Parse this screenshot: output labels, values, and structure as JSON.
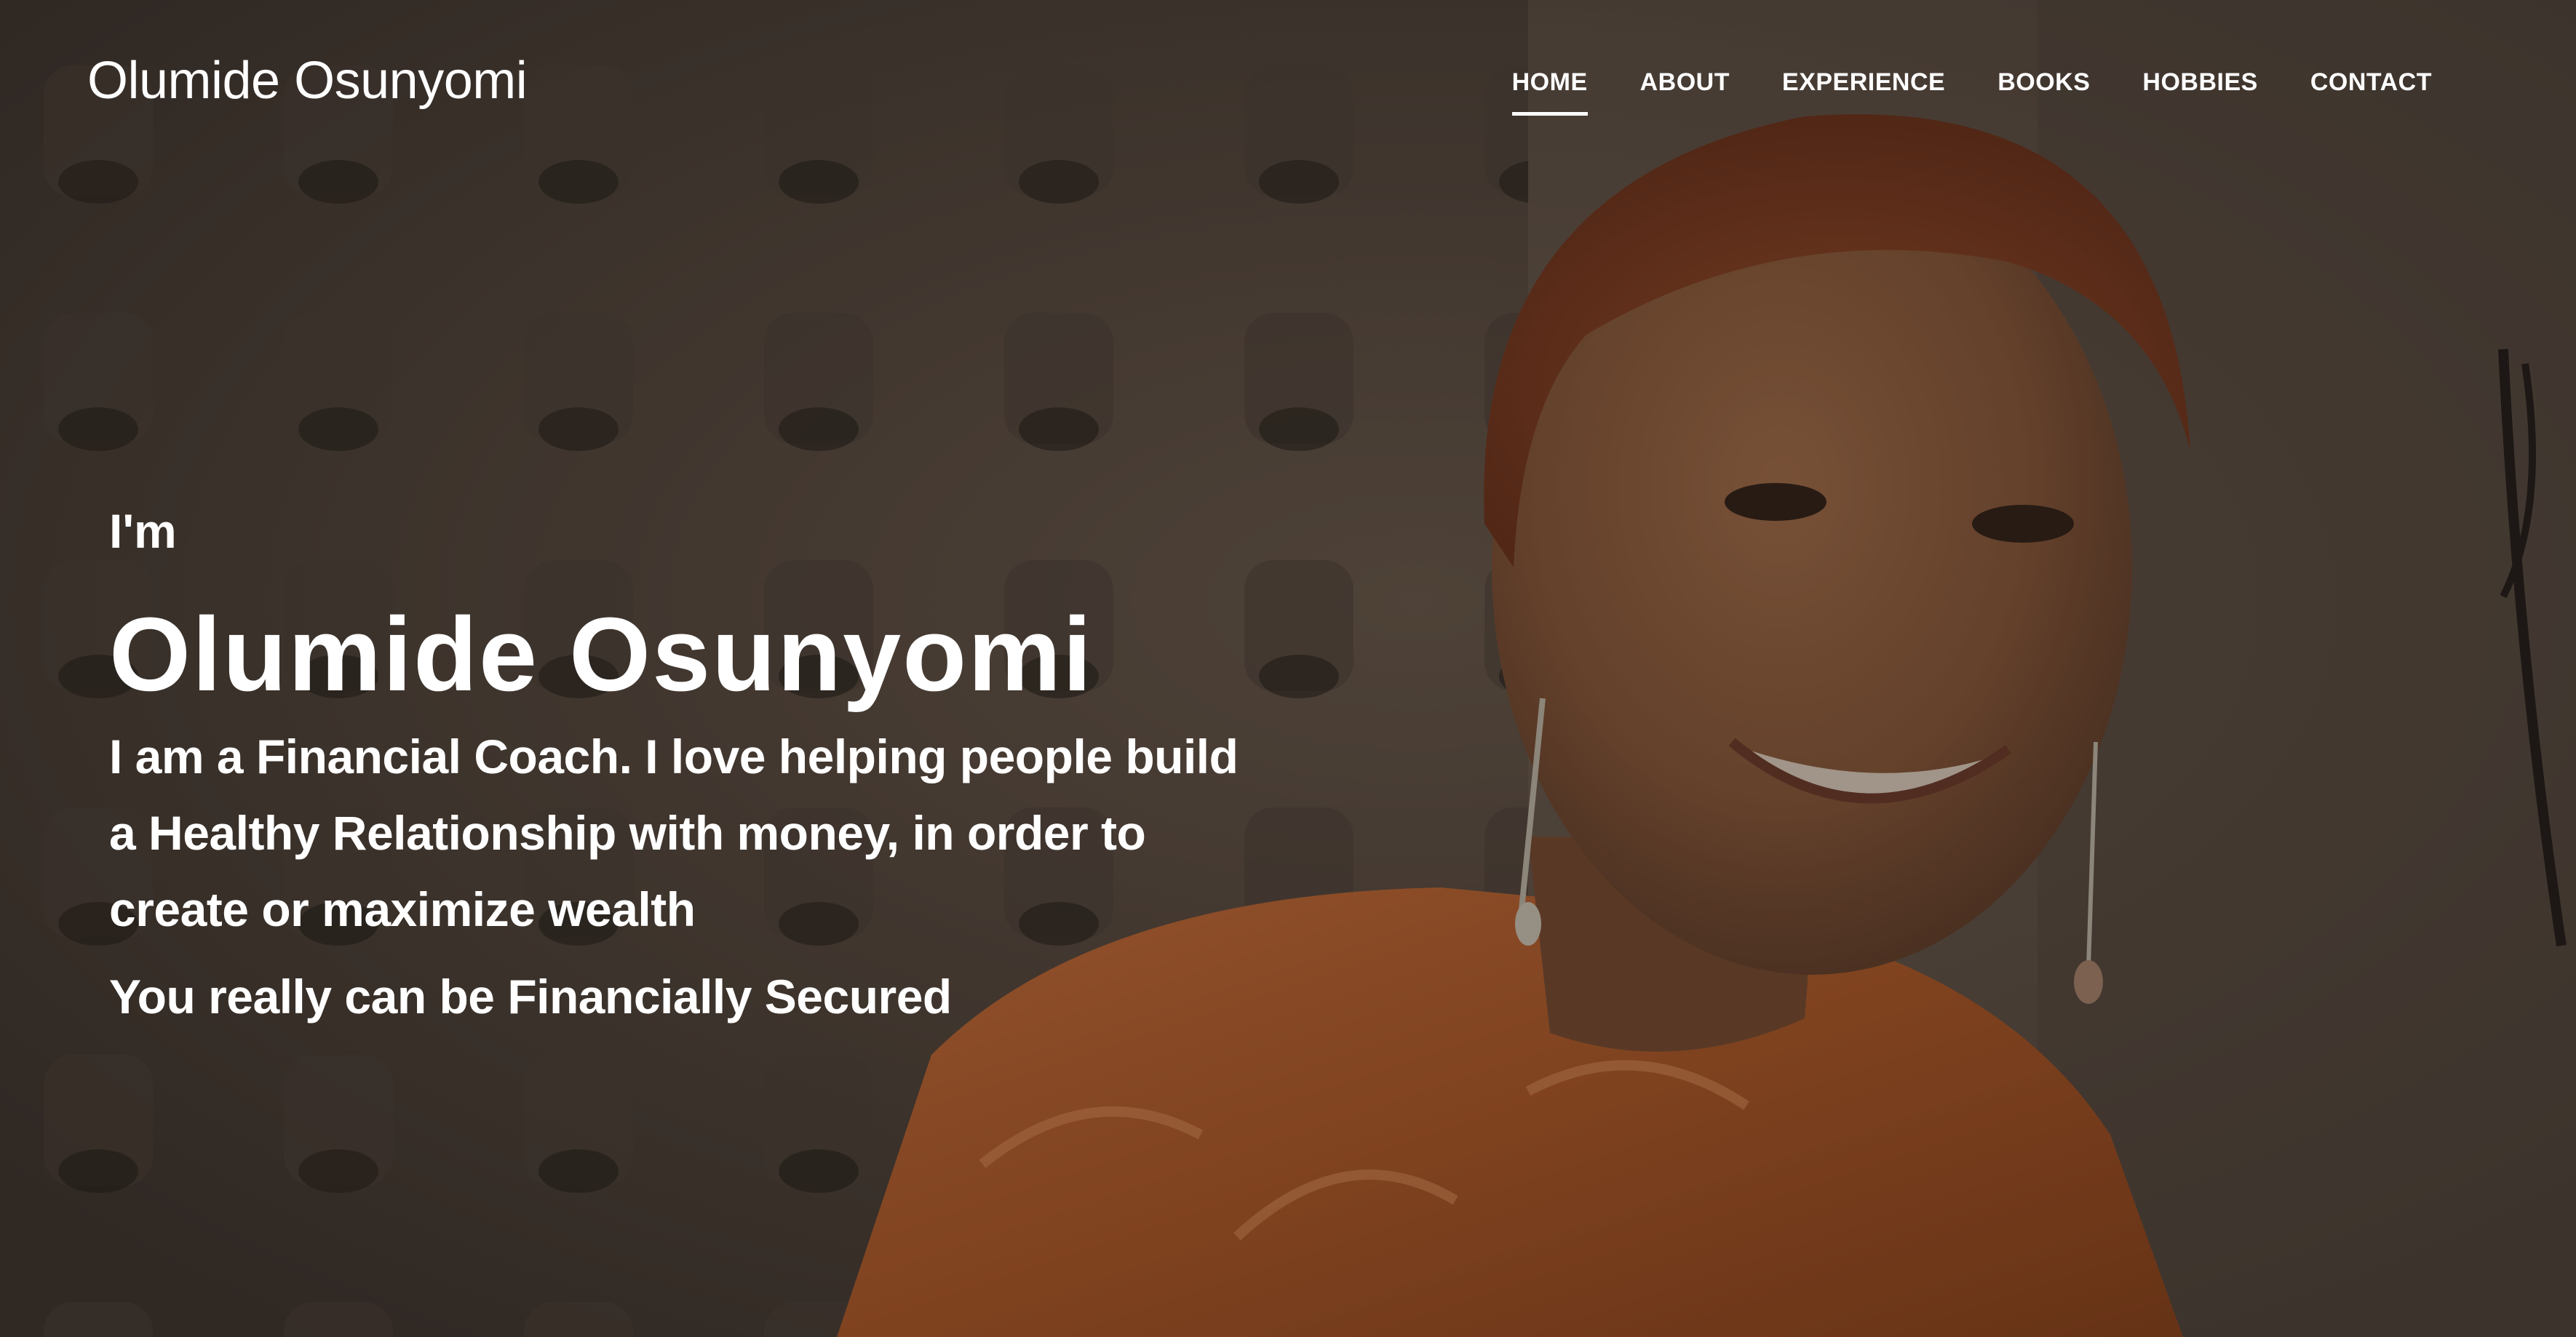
{
  "header": {
    "brand": "Olumide Osunyomi",
    "nav": [
      {
        "label": "HOME",
        "active": true
      },
      {
        "label": "ABOUT",
        "active": false
      },
      {
        "label": "EXPERIENCE",
        "active": false
      },
      {
        "label": "BOOKS",
        "active": false
      },
      {
        "label": "HOBBIES",
        "active": false
      },
      {
        "label": "CONTACT",
        "active": false
      }
    ]
  },
  "hero": {
    "intro": "I'm",
    "name": "Olumide Osunyomi",
    "tagline": "I am a Financial Coach. I love helping people build a Healthy Relationship with money, in order to create or maximize wealth",
    "motto": "You really can be Financially Secured",
    "photo_label": "portrait-photo",
    "colors": {
      "text": "#ffffff",
      "overlay": "#1e1814",
      "outfit": "#c0622a",
      "skin": "#8a5a3c",
      "hair": "#8b4226"
    }
  }
}
